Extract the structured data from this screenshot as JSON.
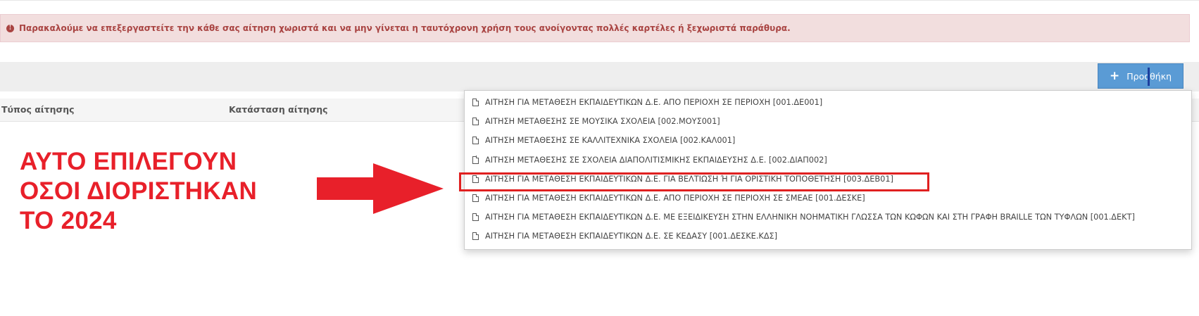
{
  "alert": {
    "icon": "exclamation-circle-icon",
    "text": "Παρακαλούμε να επεξεργαστείτε την κάθε σας αίτηση χωριστά και να μην γίνεται η ταυτόχρονη χρήση τους ανοίγοντας πολλές καρτέλες ή ξεχωριστά παράθυρα.",
    "color": "#a94442",
    "background": "#f2dede"
  },
  "toolbar": {
    "add_label": "Προσθήκη",
    "add_icon": "plus-icon",
    "button_color": "#5a9bd5"
  },
  "table": {
    "columns": [
      "Τύπος αίτησης",
      "Κατάσταση αίτησης"
    ]
  },
  "dropdown": {
    "item_icon": "file-icon",
    "items": [
      "ΑΙΤΗΣΗ ΓΙΑ ΜΕΤΑΘΕΣΗ ΕΚΠΑΙΔΕΥΤΙΚΩΝ Δ.Ε. ΑΠΟ ΠΕΡΙΟΧΗ ΣΕ ΠΕΡΙΟΧΗ [001.ΔΕ001]",
      "ΑΙΤΗΣΗ ΜΕΤΑΘΕΣΗΣ ΣΕ ΜΟΥΣΙΚΑ ΣΧΟΛΕΙΑ [002.ΜΟΥΣ001]",
      "ΑΙΤΗΣΗ ΜΕΤΑΘΕΣΗΣ ΣΕ ΚΑΛΛΙΤΕΧΝΙΚΑ ΣΧΟΛΕΙΑ [002.ΚΑΛ001]",
      "ΑΙΤΗΣΗ ΜΕΤΑΘΕΣΗΣ ΣΕ ΣΧΟΛΕΙΑ ΔΙΑΠΟΛΙΤΙΣΜΙΚΗΣ ΕΚΠΑΙΔΕΥΣΗΣ Δ.Ε. [002.ΔΙΑΠ002]",
      "ΑΙΤΗΣΗ ΓΙΑ ΜΕΤΑΘΕΣΗ ΕΚΠΑΙΔΕΥΤΙΚΩΝ Δ.Ε. ΓΙΑ ΒΕΛΤΙΩΣΗ Ή ΓΙΑ ΟΡΙΣΤΙΚΗ ΤΟΠΟΘΕΤΗΣΗ [003.ΔΕΒ01]",
      "ΑΙΤΗΣΗ ΓΙΑ ΜΕΤΑΘΕΣΗ ΕΚΠΑΙΔΕΥΤΙΚΩΝ Δ.Ε. ΑΠΟ ΠΕΡΙΟΧΗ ΣΕ ΠΕΡΙΟΧΗ ΣΕ ΣΜΕΑΕ [001.ΔΕΣΚΕ]",
      "ΑΙΤΗΣΗ ΓΙΑ ΜΕΤΑΘΕΣΗ ΕΚΠΑΙΔΕΥΤΙΚΩΝ Δ.Ε. ΜΕ ΕΞΕΙΔΙΚΕΥΣΗ ΣΤΗΝ ΕΛΛΗΝΙΚΗ ΝΟΗΜΑΤΙΚΗ ΓΛΩΣΣΑ ΤΩΝ ΚΩΦΩΝ ΚΑΙ ΣΤΗ ΓΡΑΦΗ BRAILLE ΤΩΝ ΤΥΦΛΩΝ [001.ΔΕΚΤ]",
      "ΑΙΤΗΣΗ ΓΙΑ ΜΕΤΑΘΕΣΗ ΕΚΠΑΙΔΕΥΤΙΚΩΝ Δ.Ε. ΣΕ ΚΕΔΑΣΥ [001.ΔΕΣΚΕ.ΚΔΣ]"
    ],
    "highlighted_index": 4,
    "highlight_color": "#e02020"
  },
  "annotation": {
    "lines": [
      "ΑΥΤΟ ΕΠΙΛΕΓΟΥΝ",
      "ΟΣΟΙ ΔΙΟΡΙΣΤΗΚΑΝ",
      "ΤΟ 2024"
    ],
    "color": "#e8202a",
    "arrow_icon": "right-arrow-icon"
  }
}
